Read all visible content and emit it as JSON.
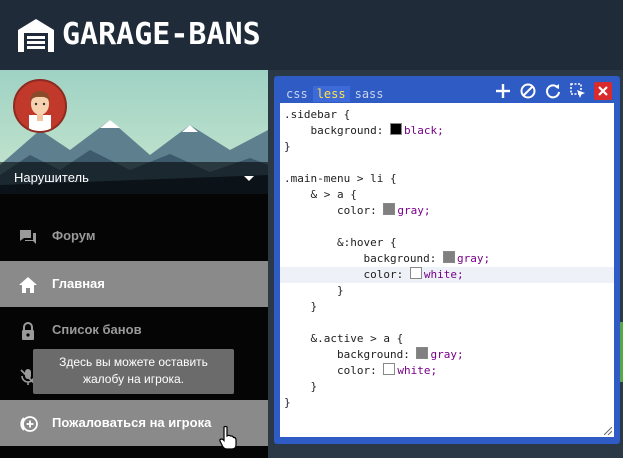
{
  "app": {
    "title": "GARAGE-BANS"
  },
  "user": {
    "name": "Нарушитель"
  },
  "menu": [
    {
      "label": "Форум",
      "icon": "forum-icon"
    },
    {
      "label": "Главная",
      "icon": "home-icon"
    },
    {
      "label": "Список банов",
      "icon": "lock-icon"
    },
    {
      "label": "",
      "icon": "mic-off-icon"
    },
    {
      "label": "Пожаловаться на игрока",
      "icon": "report-icon"
    }
  ],
  "tooltip": {
    "line1": "Здесь вы можете оставить",
    "line2": "жалобу на игрока."
  },
  "editor": {
    "tabs": [
      "css",
      "less",
      "sass"
    ],
    "active_tab": "less",
    "toolbar": [
      "plus-icon",
      "disable-icon",
      "refresh-icon",
      "select-icon",
      "close-icon"
    ],
    "code": [
      ".sidebar {",
      "    background: black;",
      "}",
      "",
      ".main-menu > li {",
      "    & > a {",
      "        color: gray;",
      "",
      "        &:hover {",
      "            background: gray;",
      "            color: white;",
      "        }",
      "    }",
      "",
      "    &.active > a {",
      "        background: gray;",
      "        color: white;",
      "    }",
      "}"
    ]
  },
  "colors": {
    "header_bg": "#1f2b38",
    "sidebar_bg": "#050505",
    "menu_active_bg": "#8a8a8a",
    "editor_bg": "#2e5bc4",
    "tab_active_text": "#ffe54a",
    "close_btn": "#d92b2b"
  }
}
